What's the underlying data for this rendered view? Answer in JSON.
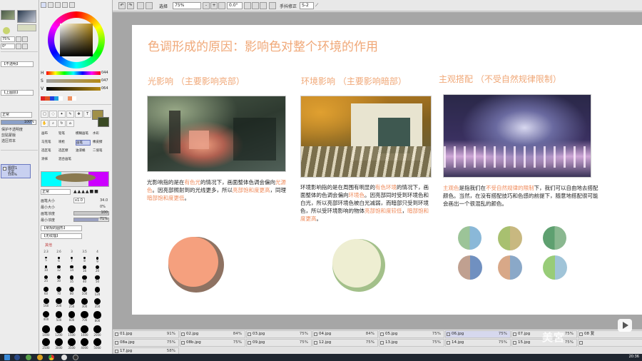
{
  "toolbar": {
    "select_label": "选择",
    "zoom": "75%",
    "angle": "0.0°",
    "stabilizer_label": "手抖修正",
    "stabilizer": "S-2"
  },
  "panel": {
    "zoom1": "75%",
    "angle1": "0°",
    "normal_label": "【不透明】",
    "layer_label": "【上图层】",
    "hsv": [
      {
        "label": "H",
        "value": "044"
      },
      {
        "label": "S",
        "value": "047"
      },
      {
        "label": "V",
        "value": "064"
      }
    ],
    "blend_mode": "正常",
    "opacity": "100%",
    "protect_label": "保护不透明度",
    "clip_label": "剪贴蒙版",
    "select_source_label": "选区样本",
    "layer_name": "图层1",
    "layer_mode": "正常",
    "layer_opacity": "100%",
    "brush_tools": [
      "画布",
      "铅笔",
      "模糊画笔",
      "水彩",
      "马克笔",
      "喷枪",
      "画笔",
      "橡皮擦",
      "选区笔",
      "选区擦",
      "油漆桶",
      "二值笔",
      "涂抹",
      "混合画笔"
    ],
    "brush_mode": "正常",
    "brush_size_label": "画笔大小",
    "brush_size_mult": "x1.0",
    "brush_size": "34.0",
    "min_size_label": "最小大小",
    "min_size": "0%",
    "density_label": "画笔浓度",
    "density": "100",
    "min_density_label": "最小浓度",
    "min_density": "71%",
    "shape_label": "【常规的圆形】",
    "texture_label": "【无纹理】",
    "advanced_label": "其他",
    "brush_sizes": [
      "2.3",
      "2.6",
      "3",
      "3.5",
      "4",
      "5",
      "6",
      "7",
      "8",
      "9",
      "10",
      "12",
      "14",
      "16",
      "20",
      "25",
      "30",
      "35",
      "40",
      "50",
      "60",
      "70",
      "80",
      "100",
      "120",
      "160",
      "200",
      "250",
      "300",
      "350",
      "400",
      "500",
      "600",
      "700",
      "800",
      "1000",
      "1200",
      "1500",
      "1600",
      "2000",
      "2500",
      "3000",
      "3500",
      "4000",
      "5000"
    ]
  },
  "doc": {
    "title": "色调形成的原因：影响色对整个环境的作用",
    "sections": [
      {
        "heading": "光影响 （主要影响亮部）",
        "text_parts": [
          {
            "t": "光影响指的是在",
            "h": false
          },
          {
            "t": "有色光",
            "h": true
          },
          {
            "t": "的情况下，画面整体色调会偏向",
            "h": false
          },
          {
            "t": "光源色",
            "h": true
          },
          {
            "t": "。因亮部照射到的光线更多，所以",
            "h": false
          },
          {
            "t": "亮部饱和度更高",
            "h": true
          },
          {
            "t": "，同理",
            "h": false
          },
          {
            "t": "暗部饱和度更低",
            "h": true
          },
          {
            "t": "。",
            "h": false
          }
        ]
      },
      {
        "heading": "环境影响 （主要影响暗部）",
        "text_parts": [
          {
            "t": "环境影响指的是在周围有明显的",
            "h": false
          },
          {
            "t": "有色环境",
            "h": true
          },
          {
            "t": "的情况下，画面整体的色调会偏向",
            "h": false
          },
          {
            "t": "环境色",
            "h": true
          },
          {
            "t": "。因亮部同时受到环境色和白光，所以亮部环境色被白光减弱，而暗部只受到环境色，所以受环境影响的物体",
            "h": false
          },
          {
            "t": "亮部饱和度较低",
            "h": true
          },
          {
            "t": "，",
            "h": false
          },
          {
            "t": "暗部饱和度更高",
            "h": true
          },
          {
            "t": "。",
            "h": false
          }
        ]
      },
      {
        "heading": "主观搭配 （不受自然规律限制）",
        "text_parts": [
          {
            "t": "主观色",
            "h": true
          },
          {
            "t": "是指我们在",
            "h": false
          },
          {
            "t": "不受自然规律的限制",
            "h": true
          },
          {
            "t": "下，我们可以自由地去搭配颜色。当然，在没有搭配技巧和色感的前提下，随意地搭配很可能会画出一个很混乱的颜色。",
            "h": false
          }
        ]
      }
    ],
    "colors": {
      "heading": "#f0a878",
      "highlight": "#ef8a5a",
      "ball1_light": "#f5a07e",
      "ball1_dark": "#8e7262",
      "ball2_light": "#eeeed2",
      "ball2_dark": "#a3c08a"
    }
  },
  "files": [
    {
      "name": "01.jpg",
      "pct": "91%"
    },
    {
      "name": "02.jpg",
      "pct": "84%"
    },
    {
      "name": "03.jpg",
      "pct": "75%"
    },
    {
      "name": "04.jpg",
      "pct": "84%"
    },
    {
      "name": "05.jpg",
      "pct": "75%"
    },
    {
      "name": "06.jpg",
      "pct": "75%",
      "active": true
    },
    {
      "name": "07.jpg",
      "pct": "75%"
    },
    {
      "name": "08 复",
      "pct": ""
    },
    {
      "name": "08a.jpg",
      "pct": "75%"
    },
    {
      "name": "08b.jpg",
      "pct": "75%"
    },
    {
      "name": "09.jpg",
      "pct": "75%"
    },
    {
      "name": "12.jpg",
      "pct": "75%"
    },
    {
      "name": "13.jpg",
      "pct": "75%"
    },
    {
      "name": "14.jpg",
      "pct": "75%"
    },
    {
      "name": "15.jpg",
      "pct": "75%"
    },
    {
      "name": "",
      "pct": ""
    },
    {
      "name": "17.jpg",
      "pct": "58%"
    }
  ],
  "watermark": "美宮",
  "clock": "20:36",
  "icons": [
    "play-icon",
    "windows-start-icon",
    "chrome-icon",
    "folder-icon"
  ]
}
